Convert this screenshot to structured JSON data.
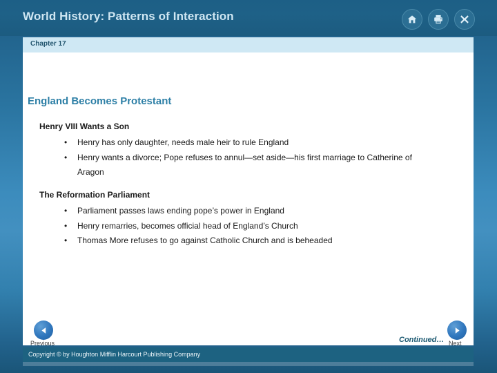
{
  "header": {
    "title": "World History: Patterns of Interaction",
    "icons": [
      {
        "name": "home-icon",
        "label": "Home"
      },
      {
        "name": "print-icon",
        "label": "Print"
      },
      {
        "name": "close-icon",
        "label": "Close"
      }
    ]
  },
  "chapter": {
    "label": "Chapter 17"
  },
  "slide": {
    "title": "England Becomes Protestant",
    "sections": [
      {
        "heading": "Henry VIII Wants a Son",
        "bullets": [
          "Henry has only daughter, needs male heir to rule England",
          "Henry wants a divorce; Pope refuses to annul—set aside—his first marriage to Catherine of Aragon"
        ]
      },
      {
        "heading": "The Reformation Parliament",
        "bullets": [
          "Parliament passes laws ending pope’s power in England",
          "Henry remarries, becomes official head of England’s Church",
          "Thomas More refuses to go against Catholic Church and is beheaded"
        ]
      }
    ]
  },
  "footer": {
    "previous_label": "Previous",
    "next_label": "Next",
    "continued_label": "Continued…",
    "copyright": "Copyright © by Houghton Mifflin Harcourt Publishing Company"
  },
  "colors": {
    "frame_blue": "#2a74a0",
    "header_blue": "#1d5f86",
    "chapter_bar": "#cfe8f4",
    "title_teal": "#2d7fa6",
    "copyright_bar": "#1d6281",
    "nav_button": "#2f76bd"
  }
}
